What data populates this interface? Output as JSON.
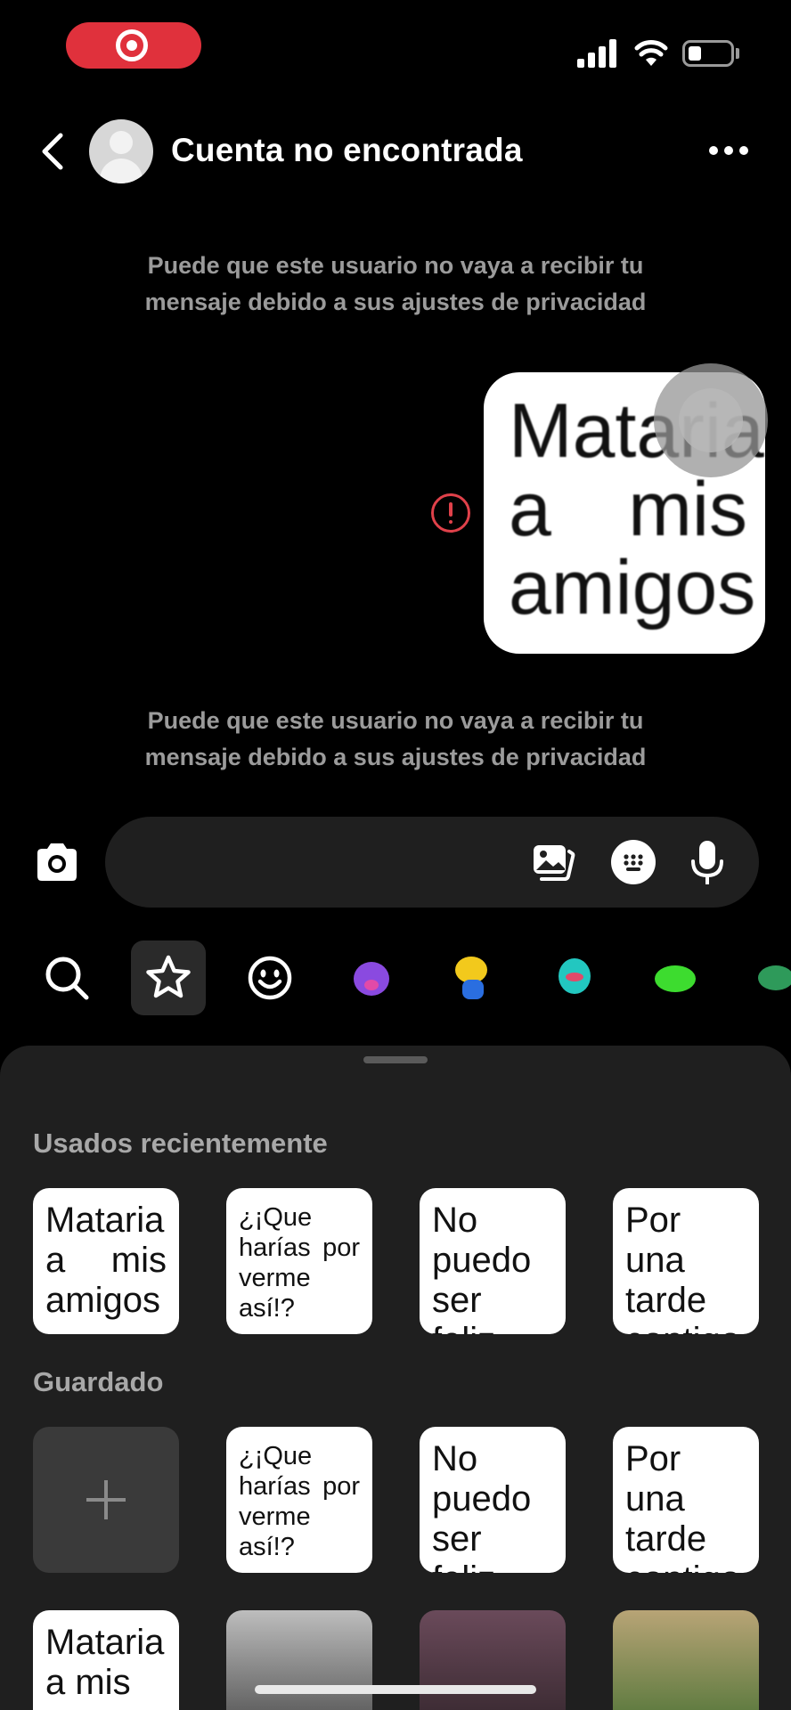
{
  "header": {
    "title": "Cuenta no encontrada"
  },
  "notices": {
    "first": "Puede que este usuario no vaya a recibir tu mensaje debido a sus ajustes de privacidad",
    "second": "Puede que este usuario no vaya a recibir tu mensaje debido a sus ajustes de privacidad"
  },
  "message": {
    "sticker_text": "Mataria a mis amigos",
    "status": "error"
  },
  "composer": {
    "value": "",
    "placeholder": ""
  },
  "sticker_tabs": [
    "search-icon",
    "star-icon",
    "smiley-icon",
    "sticker-1",
    "sticker-2",
    "sticker-3",
    "sticker-4",
    "sticker-5"
  ],
  "sheet": {
    "recent_title": "Usados recientemente",
    "saved_title": "Guardado",
    "recent": [
      "Mataria a mis amigos",
      "¿¡Que harías por verme así!?",
      "No puedo ser feliz",
      "Por una tarde contigo"
    ],
    "saved": [
      "¿¡Que harías por verme así!?",
      "No puedo ser feliz",
      "Por una tarde contigo"
    ],
    "row3_first": "Mataria a mis"
  },
  "colors": {
    "background": "#000000",
    "sheet": "#1f1f1f",
    "error": "#e0414a",
    "recording": "#e0313c"
  }
}
